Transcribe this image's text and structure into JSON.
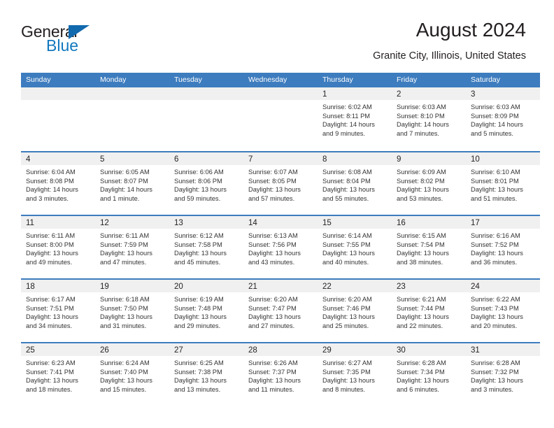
{
  "brand": {
    "name_top": "General",
    "name_bottom": "Blue",
    "triangle_icon": "triangle-icon",
    "color_dark": "#231f20",
    "color_blue": "#1278be"
  },
  "header": {
    "title": "August 2024",
    "subtitle": "Granite City, Illinois, United States"
  },
  "theme": {
    "header_blue": "#3d7cbe",
    "day_band_gray": "#f0f0f0",
    "text": "#231f20"
  },
  "weekdays": [
    "Sunday",
    "Monday",
    "Tuesday",
    "Wednesday",
    "Thursday",
    "Friday",
    "Saturday"
  ],
  "weeks": [
    [
      {
        "day": "",
        "sunrise": "",
        "sunset": "",
        "daylight": "",
        "daylight2": ""
      },
      {
        "day": "",
        "sunrise": "",
        "sunset": "",
        "daylight": "",
        "daylight2": ""
      },
      {
        "day": "",
        "sunrise": "",
        "sunset": "",
        "daylight": "",
        "daylight2": ""
      },
      {
        "day": "",
        "sunrise": "",
        "sunset": "",
        "daylight": "",
        "daylight2": ""
      },
      {
        "day": "1",
        "sunrise": "Sunrise: 6:02 AM",
        "sunset": "Sunset: 8:11 PM",
        "daylight": "Daylight: 14 hours",
        "daylight2": "and 9 minutes."
      },
      {
        "day": "2",
        "sunrise": "Sunrise: 6:03 AM",
        "sunset": "Sunset: 8:10 PM",
        "daylight": "Daylight: 14 hours",
        "daylight2": "and 7 minutes."
      },
      {
        "day": "3",
        "sunrise": "Sunrise: 6:03 AM",
        "sunset": "Sunset: 8:09 PM",
        "daylight": "Daylight: 14 hours",
        "daylight2": "and 5 minutes."
      }
    ],
    [
      {
        "day": "4",
        "sunrise": "Sunrise: 6:04 AM",
        "sunset": "Sunset: 8:08 PM",
        "daylight": "Daylight: 14 hours",
        "daylight2": "and 3 minutes."
      },
      {
        "day": "5",
        "sunrise": "Sunrise: 6:05 AM",
        "sunset": "Sunset: 8:07 PM",
        "daylight": "Daylight: 14 hours",
        "daylight2": "and 1 minute."
      },
      {
        "day": "6",
        "sunrise": "Sunrise: 6:06 AM",
        "sunset": "Sunset: 8:06 PM",
        "daylight": "Daylight: 13 hours",
        "daylight2": "and 59 minutes."
      },
      {
        "day": "7",
        "sunrise": "Sunrise: 6:07 AM",
        "sunset": "Sunset: 8:05 PM",
        "daylight": "Daylight: 13 hours",
        "daylight2": "and 57 minutes."
      },
      {
        "day": "8",
        "sunrise": "Sunrise: 6:08 AM",
        "sunset": "Sunset: 8:04 PM",
        "daylight": "Daylight: 13 hours",
        "daylight2": "and 55 minutes."
      },
      {
        "day": "9",
        "sunrise": "Sunrise: 6:09 AM",
        "sunset": "Sunset: 8:02 PM",
        "daylight": "Daylight: 13 hours",
        "daylight2": "and 53 minutes."
      },
      {
        "day": "10",
        "sunrise": "Sunrise: 6:10 AM",
        "sunset": "Sunset: 8:01 PM",
        "daylight": "Daylight: 13 hours",
        "daylight2": "and 51 minutes."
      }
    ],
    [
      {
        "day": "11",
        "sunrise": "Sunrise: 6:11 AM",
        "sunset": "Sunset: 8:00 PM",
        "daylight": "Daylight: 13 hours",
        "daylight2": "and 49 minutes."
      },
      {
        "day": "12",
        "sunrise": "Sunrise: 6:11 AM",
        "sunset": "Sunset: 7:59 PM",
        "daylight": "Daylight: 13 hours",
        "daylight2": "and 47 minutes."
      },
      {
        "day": "13",
        "sunrise": "Sunrise: 6:12 AM",
        "sunset": "Sunset: 7:58 PM",
        "daylight": "Daylight: 13 hours",
        "daylight2": "and 45 minutes."
      },
      {
        "day": "14",
        "sunrise": "Sunrise: 6:13 AM",
        "sunset": "Sunset: 7:56 PM",
        "daylight": "Daylight: 13 hours",
        "daylight2": "and 43 minutes."
      },
      {
        "day": "15",
        "sunrise": "Sunrise: 6:14 AM",
        "sunset": "Sunset: 7:55 PM",
        "daylight": "Daylight: 13 hours",
        "daylight2": "and 40 minutes."
      },
      {
        "day": "16",
        "sunrise": "Sunrise: 6:15 AM",
        "sunset": "Sunset: 7:54 PM",
        "daylight": "Daylight: 13 hours",
        "daylight2": "and 38 minutes."
      },
      {
        "day": "17",
        "sunrise": "Sunrise: 6:16 AM",
        "sunset": "Sunset: 7:52 PM",
        "daylight": "Daylight: 13 hours",
        "daylight2": "and 36 minutes."
      }
    ],
    [
      {
        "day": "18",
        "sunrise": "Sunrise: 6:17 AM",
        "sunset": "Sunset: 7:51 PM",
        "daylight": "Daylight: 13 hours",
        "daylight2": "and 34 minutes."
      },
      {
        "day": "19",
        "sunrise": "Sunrise: 6:18 AM",
        "sunset": "Sunset: 7:50 PM",
        "daylight": "Daylight: 13 hours",
        "daylight2": "and 31 minutes."
      },
      {
        "day": "20",
        "sunrise": "Sunrise: 6:19 AM",
        "sunset": "Sunset: 7:48 PM",
        "daylight": "Daylight: 13 hours",
        "daylight2": "and 29 minutes."
      },
      {
        "day": "21",
        "sunrise": "Sunrise: 6:20 AM",
        "sunset": "Sunset: 7:47 PM",
        "daylight": "Daylight: 13 hours",
        "daylight2": "and 27 minutes."
      },
      {
        "day": "22",
        "sunrise": "Sunrise: 6:20 AM",
        "sunset": "Sunset: 7:46 PM",
        "daylight": "Daylight: 13 hours",
        "daylight2": "and 25 minutes."
      },
      {
        "day": "23",
        "sunrise": "Sunrise: 6:21 AM",
        "sunset": "Sunset: 7:44 PM",
        "daylight": "Daylight: 13 hours",
        "daylight2": "and 22 minutes."
      },
      {
        "day": "24",
        "sunrise": "Sunrise: 6:22 AM",
        "sunset": "Sunset: 7:43 PM",
        "daylight": "Daylight: 13 hours",
        "daylight2": "and 20 minutes."
      }
    ],
    [
      {
        "day": "25",
        "sunrise": "Sunrise: 6:23 AM",
        "sunset": "Sunset: 7:41 PM",
        "daylight": "Daylight: 13 hours",
        "daylight2": "and 18 minutes."
      },
      {
        "day": "26",
        "sunrise": "Sunrise: 6:24 AM",
        "sunset": "Sunset: 7:40 PM",
        "daylight": "Daylight: 13 hours",
        "daylight2": "and 15 minutes."
      },
      {
        "day": "27",
        "sunrise": "Sunrise: 6:25 AM",
        "sunset": "Sunset: 7:38 PM",
        "daylight": "Daylight: 13 hours",
        "daylight2": "and 13 minutes."
      },
      {
        "day": "28",
        "sunrise": "Sunrise: 6:26 AM",
        "sunset": "Sunset: 7:37 PM",
        "daylight": "Daylight: 13 hours",
        "daylight2": "and 11 minutes."
      },
      {
        "day": "29",
        "sunrise": "Sunrise: 6:27 AM",
        "sunset": "Sunset: 7:35 PM",
        "daylight": "Daylight: 13 hours",
        "daylight2": "and 8 minutes."
      },
      {
        "day": "30",
        "sunrise": "Sunrise: 6:28 AM",
        "sunset": "Sunset: 7:34 PM",
        "daylight": "Daylight: 13 hours",
        "daylight2": "and 6 minutes."
      },
      {
        "day": "31",
        "sunrise": "Sunrise: 6:28 AM",
        "sunset": "Sunset: 7:32 PM",
        "daylight": "Daylight: 13 hours",
        "daylight2": "and 3 minutes."
      }
    ]
  ]
}
